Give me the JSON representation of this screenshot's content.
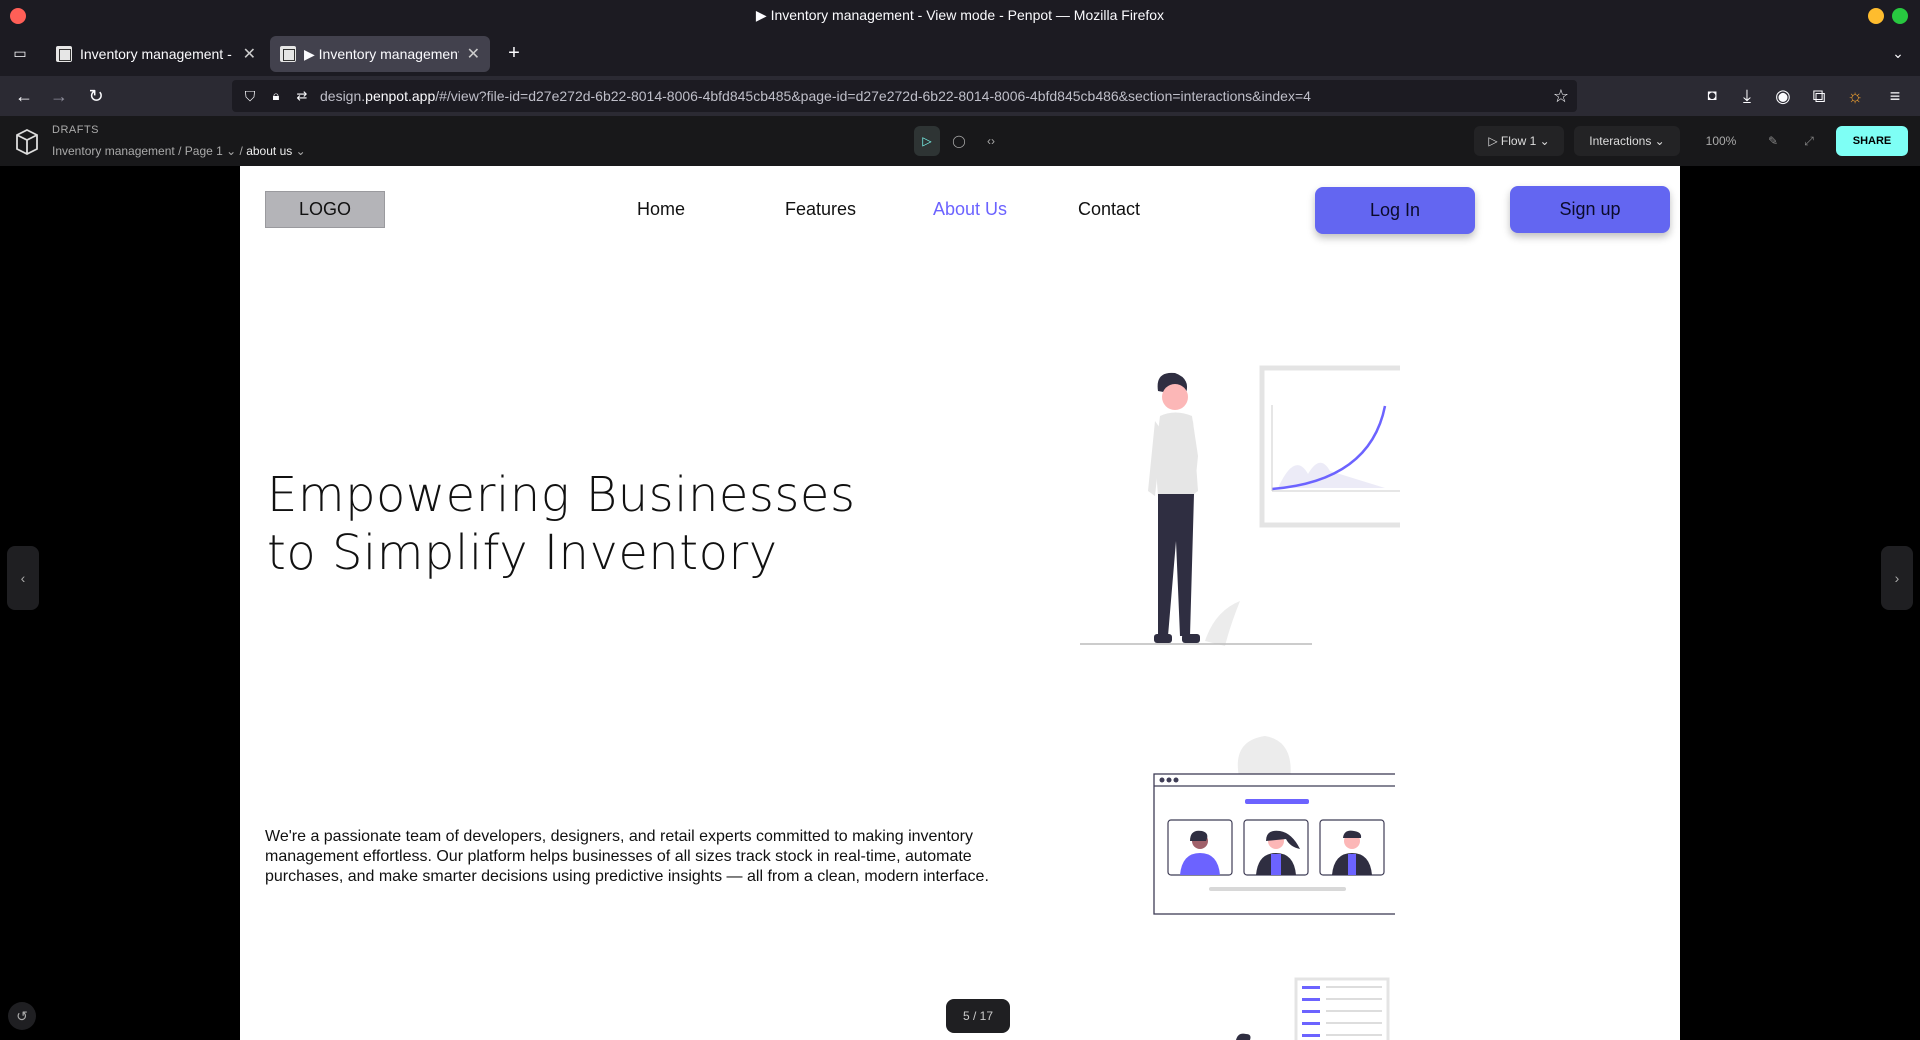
{
  "window": {
    "title": "▶ Inventory management - View mode - Penpot — Mozilla Firefox"
  },
  "tabs": [
    {
      "label": "Inventory management - Penpot"
    },
    {
      "label": "▶ Inventory management - View mode"
    }
  ],
  "urlbar": {
    "prefix": "design.",
    "domain": "penpot.app",
    "path": "/#/view?file-id=d27e272d-6b22-8014-8006-4bfd845cb485&page-id=d27e272d-6b22-8014-8006-4bfd845cb486&section=interactions&index=4"
  },
  "penpot": {
    "section": "DRAFTS",
    "project": "Inventory management",
    "page": "Page 1",
    "board": "about us",
    "flow": "Flow 1",
    "mode": "Interactions",
    "zoom": "100%",
    "share": "SHARE",
    "pager": "5 / 17"
  },
  "site": {
    "logo": "LOGO",
    "nav": [
      "Home",
      "Features",
      "About Us",
      "Contact"
    ],
    "login": "Log In",
    "signup": "Sign up",
    "headline_1": "Empowering Businesses",
    "headline_2": "to Simplify Inventory",
    "paragraph": "We're a passionate team of developers, designers, and retail experts committed to making inventory management effortless. Our platform helps businesses of all sizes track stock in real-time, automate purchases, and make smarter decisions using predictive insights — all from a clean, modern interface."
  },
  "colors": {
    "accent": "#6366f1",
    "share": "#7efff5"
  },
  "icons": [
    "back-icon",
    "forward-icon",
    "reload-icon",
    "shield-icon",
    "lock-icon",
    "star-icon",
    "pocket-icon",
    "download-icon",
    "account-icon",
    "extensions-icon",
    "menu-icon",
    "penpot-logo-icon",
    "play-icon",
    "comment-icon",
    "code-icon",
    "edit-icon",
    "fullscreen-icon"
  ]
}
